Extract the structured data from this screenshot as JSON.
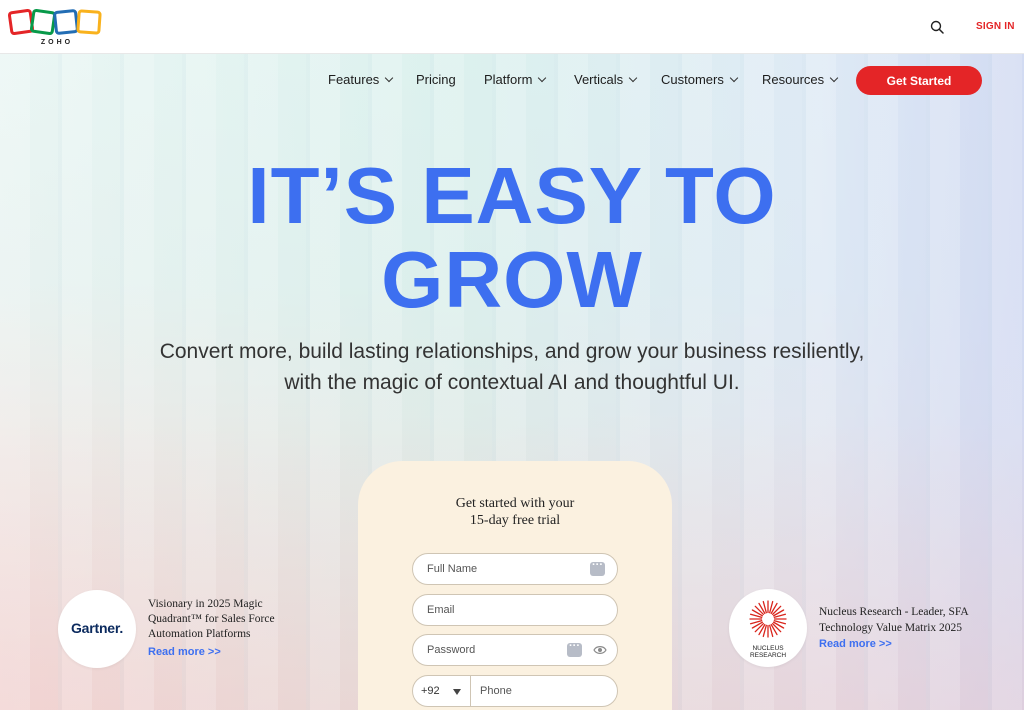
{
  "header": {
    "logo_text": "ZOHO",
    "signin_label": "SIGN IN"
  },
  "nav": {
    "items": [
      {
        "label": "Features",
        "has_dropdown": true
      },
      {
        "label": "Pricing",
        "has_dropdown": false
      },
      {
        "label": "Platform",
        "has_dropdown": true
      },
      {
        "label": "Verticals",
        "has_dropdown": true
      },
      {
        "label": "Customers",
        "has_dropdown": true
      },
      {
        "label": "Resources",
        "has_dropdown": true
      }
    ],
    "cta_label": "Get Started"
  },
  "hero": {
    "headline_line1": "IT’S EASY TO",
    "headline_line2": "GROW",
    "subtext_line1": "Convert more, build lasting relationships, and grow your business resiliently,",
    "subtext_line2": "with the magic of contextual AI and thoughtful UI."
  },
  "signup_form": {
    "title_line1": "Get started with your",
    "title_line2": "15-day free trial",
    "full_name_placeholder": "Full Name",
    "email_placeholder": "Email",
    "password_placeholder": "Password",
    "country_code": "+92",
    "phone_placeholder": "Phone"
  },
  "badges": {
    "gartner": {
      "logo_text": "Gartner.",
      "line1": "Visionary in 2025 Magic",
      "line2": "Quadrant™ for Sales Force",
      "line3": "Automation Platforms",
      "read_more": "Read more >>"
    },
    "nucleus": {
      "logo_line1": "NUCLEUS",
      "logo_line2": "RESEARCH",
      "line1": "Nucleus Research - Leader, SFA",
      "line2": "Technology Value Matrix 2025",
      "read_more": "Read more >>"
    }
  },
  "colors": {
    "brand_red": "#e42527",
    "headline_blue": "#3d6ff0",
    "form_bg": "#fbf1e0"
  }
}
